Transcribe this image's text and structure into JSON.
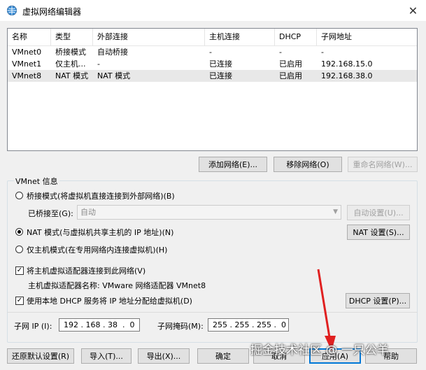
{
  "window": {
    "title": "虚拟网络编辑器",
    "close": "✕"
  },
  "network_list": {
    "columns": [
      "名称",
      "类型",
      "外部连接",
      "主机连接",
      "DHCP",
      "子网地址"
    ],
    "rows": [
      [
        "VMnet0",
        "桥接模式",
        "自动桥接",
        "-",
        "-",
        "-"
      ],
      [
        "VMnet1",
        "仅主机...",
        "-",
        "已连接",
        "已启用",
        "192.168.15.0"
      ],
      [
        "VMnet8",
        "NAT 模式",
        "NAT 模式",
        "已连接",
        "已启用",
        "192.168.38.0"
      ]
    ],
    "selected_row": 2
  },
  "list_buttons": {
    "add": "添加网络(E)...",
    "remove": "移除网络(O)",
    "rename": "重命名网络(W)..."
  },
  "vmnet_info": {
    "legend": "VMnet 信息",
    "bridged_label": "桥接模式(将虚拟机直接连接到外部网络)(B)",
    "bridged_to_label": "已桥接至(G):",
    "bridged_to_value": "自动",
    "auto_settings": "自动设置(U)...",
    "nat_label": "NAT 模式(与虚拟机共享主机的 IP 地址)(N)",
    "nat_settings": "NAT 设置(S)...",
    "hostonly_label": "仅主机模式(在专用网络内连接虚拟机)(H)",
    "selected_mode": "nat",
    "connect_adapter_label": "将主机虚拟适配器连接到此网络(V)",
    "connect_adapter_checked": true,
    "adapter_name_label": "主机虚拟适配器名称: VMware 网络适配器 VMnet8",
    "dhcp_label": "使用本地 DHCP 服务将 IP 地址分配给虚拟机(D)",
    "dhcp_checked": true,
    "dhcp_settings": "DHCP 设置(P)...",
    "subnet_ip_label": "子网 IP (I):",
    "subnet_ip_value": "192 . 168 . 38  .  0",
    "subnet_mask_label": "子网掩码(M):",
    "subnet_mask_value": "255 . 255 . 255 .  0"
  },
  "bottom_buttons": {
    "restore": "还原默认设置(R)",
    "import": "导入(T)...",
    "export": "导出(X)...",
    "ok": "确定",
    "cancel": "取消",
    "apply": "应用(A)",
    "help": "帮助"
  },
  "watermark": "掘金技术社区 @ 一只公羊",
  "colors": {
    "accent": "#0078d7",
    "arrow": "#e02020"
  }
}
